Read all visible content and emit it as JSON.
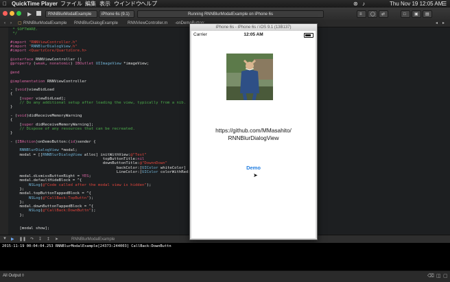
{
  "menubar": {
    "app": "QuickTime Player",
    "items": [
      "ファイル",
      "編集",
      "表示",
      "ウインドウ",
      "ヘルプ"
    ],
    "clock": "Thu Nov 19  12:05 AM"
  },
  "toolbar": {
    "scheme": "RNNBlurModalExample",
    "device": "iPhone 6s (9.1)",
    "activity": "Running RNNBlurModalExample on iPhone 6s"
  },
  "pathbar": {
    "crumbs": [
      "RNNBlurModalExample",
      "RNNBlurDialogExample",
      "RNNViewController.m",
      "-onDemoButton:"
    ]
  },
  "code_lines": [
    " * SOFTWARE.",
    " */",
    "",
    "#import \"RNNViewController.h\"",
    "#import \"RNNBlurDialogView.h\"",
    "#import <QuartzCore/QuartzCore.h>",
    "",
    "@interface RNNViewController ()",
    "@property (weak, nonatomic) IBOutlet UIImageView *imageView;",
    "",
    "@end",
    "",
    "@implementation RNNViewController",
    "",
    "- (void)viewDidLoad",
    "{",
    "    [super viewDidLoad];",
    "    // Do any additional setup after loading the view, typically from a nib.",
    "}",
    "",
    "- (void)didReceiveMemoryWarning",
    "{",
    "    [super didReceiveMemoryWarning];",
    "    // Dispose of any resources that can be recreated.",
    "}",
    "",
    "- (IBAction)onDemoButton:(id)sender {",
    "",
    "    RNNBlurDialogView *modal;",
    "    modal = [[RNNBlurDialogView alloc] initWithView:@\"Test\"",
    "                                        topButtonTitle:nil",
    "                                        downButtonTitle:@\"DownnDown\"",
    "                                              backColor:[UIColor whiteColor]",
    "                                              LineColor:[UIColor colorWithRed:0.7896",
    "    modal.dismissButtonRight = YES;",
    "    modal.defaultHideBlock = ^{",
    "        NSLog(@\"Code called after the modal view is hidden\");",
    "    };",
    "    modal.topButtonTappedBlock = ^{",
    "        NSLog(@\"CallBack:TopButtn\");",
    "    };",
    "    modal.downButtonTappedBlock = ^{",
    "        NSLog(@\"CallBack:DownButtn\");",
    "    };",
    "",
    "",
    "    [modal show];"
  ],
  "debugbar": {
    "target": "RNNBlurModalExample"
  },
  "console": {
    "line": "2015-11-19 00:04:04.253 RNNBlurModalExample[24373:244003] CallBack:DownButtn"
  },
  "statusbar": {
    "output_label": "All Output ◊"
  },
  "simulator": {
    "title": "iPhone 6s - iPhone 6s / iOS 9.1 (13B137)",
    "carrier": "Carrier",
    "time": "12:05 AM",
    "url_line1": "https://github.com/MMasahito/",
    "url_line2": "RNNBlurDialogView",
    "demo_button": "Demo"
  },
  "colors": {
    "accent": "#1f7ce0",
    "editor_bg": "#1d1f21",
    "keyword": "#d865a2",
    "string": "#e0453d",
    "comment": "#4cae4b"
  }
}
